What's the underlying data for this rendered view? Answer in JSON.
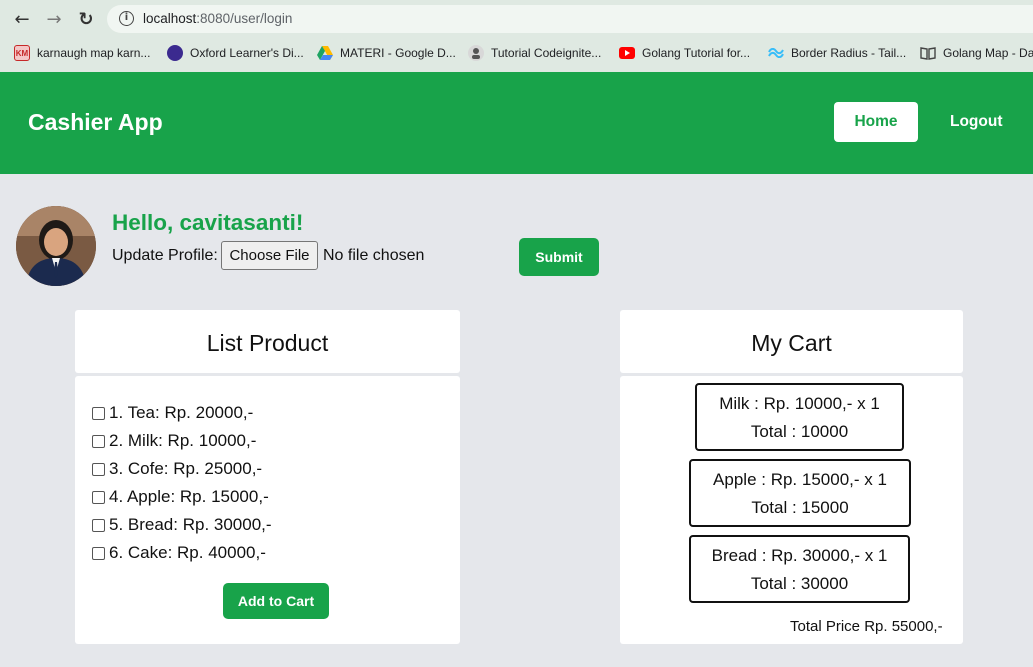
{
  "browser": {
    "url_host": "localhost",
    "url_rest": ":8080/user/login",
    "back_icon": "arrow-left-icon",
    "forward_icon": "arrow-right-icon",
    "reload_icon": "reload-icon",
    "info_icon": "info-icon",
    "bookmarks": [
      {
        "label": "karnaugh map karn...",
        "icon": "km-icon",
        "color": "#e53935"
      },
      {
        "label": "Oxford Learner's Di...",
        "icon": "oxford-icon",
        "color": "#3b2a8f"
      },
      {
        "label": "MATERI - Google D...",
        "icon": "google-drive-icon",
        "color": "#1fa463"
      },
      {
        "label": "Tutorial Codeignite...",
        "icon": "person-icon",
        "color": "#888888"
      },
      {
        "label": "Golang Tutorial for...",
        "icon": "youtube-icon",
        "color": "#ff0000"
      },
      {
        "label": "Border Radius - Tail...",
        "icon": "tailwind-icon",
        "color": "#38bdf8"
      },
      {
        "label": "Golang Map - Da",
        "icon": "book-icon",
        "color": "#555555"
      }
    ]
  },
  "header": {
    "brand": "Cashier App",
    "home": "Home",
    "logout": "Logout",
    "color": "#18a34a"
  },
  "profile": {
    "greeting": "Hello, cavitasanti!",
    "update_label": "Update Profile:",
    "choose_file": "Choose File",
    "file_status": "No file chosen",
    "submit": "Submit"
  },
  "products": {
    "title": "List Product",
    "items": [
      "1. Tea: Rp. 20000,-",
      "2. Milk: Rp. 10000,-",
      "3. Cofe: Rp. 25000,-",
      "4. Apple: Rp. 15000,-",
      "5. Bread: Rp. 30000,-",
      "6. Cake: Rp. 40000,-"
    ],
    "add_button": "Add to Cart"
  },
  "cart": {
    "title": "My Cart",
    "items": [
      {
        "line": "Milk : Rp. 10000,- x 1",
        "total": "Total : 10000"
      },
      {
        "line": "Apple : Rp. 15000,- x 1",
        "total": "Total : 15000"
      },
      {
        "line": "Bread : Rp. 30000,- x 1",
        "total": "Total : 30000"
      }
    ],
    "total_price": "Total Price Rp. 55000,-"
  }
}
